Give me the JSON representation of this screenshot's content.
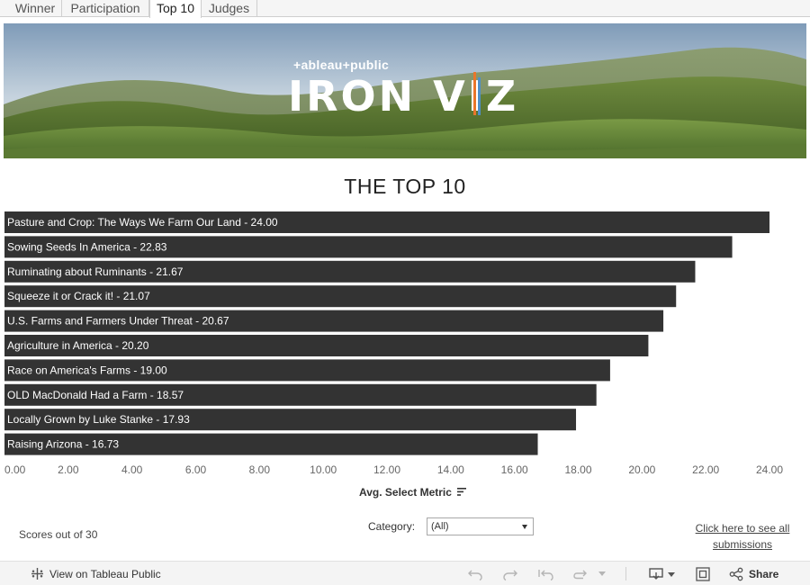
{
  "tabs": [
    {
      "label": "Winner"
    },
    {
      "label": "Participation"
    },
    {
      "label": "Top 10"
    },
    {
      "label": "Judges"
    }
  ],
  "active_tab": "Top 10",
  "banner": {
    "brand_text": "+ableau+public",
    "logo_text": "IRON VIZ"
  },
  "chart_data": {
    "type": "bar",
    "orientation": "horizontal",
    "title": "THE TOP 10",
    "xlabel": "Avg. Select Metric",
    "xlim": [
      0,
      24.8
    ],
    "ticks": [
      "0.00",
      "2.00",
      "4.00",
      "6.00",
      "8.00",
      "10.00",
      "12.00",
      "14.00",
      "16.00",
      "18.00",
      "20.00",
      "22.00",
      "24.00"
    ],
    "categories": [
      "Pasture and Crop: The Ways We Farm Our Land",
      "Sowing Seeds In America",
      "Ruminating about Ruminants",
      "Squeeze it or Crack it!",
      "U.S. Farms and Farmers Under Threat",
      "Agriculture in America",
      "Race on America's Farms",
      "OLD MacDonald Had a Farm",
      "Locally Grown by Luke Stanke",
      "Raising Arizona"
    ],
    "values": [
      24.0,
      22.83,
      21.67,
      21.07,
      20.67,
      20.2,
      19.0,
      18.57,
      17.93,
      16.73
    ],
    "labels": [
      "Pasture and Crop: The Ways We Farm Our Land - 24.00",
      "Sowing Seeds In America - 22.83",
      "Ruminating about Ruminants - 21.67",
      "Squeeze it or Crack it! - 21.07",
      "U.S. Farms and Farmers Under Threat - 20.67",
      "Agriculture in America - 20.20",
      "Race on America's Farms - 19.00",
      "OLD MacDonald Had a Farm - 18.57",
      "Locally Grown by Luke Stanke - 17.93",
      "Raising Arizona - 16.73"
    ],
    "bar_color": "#333333",
    "label_color": "#ffffff",
    "grid": false
  },
  "footer": {
    "scores_note": "Scores out of 30",
    "category_label": "Category:",
    "category_value": "(All)",
    "submissions_link": "Click here to see all submissions"
  },
  "toolbar": {
    "view_label": "View on Tableau Public",
    "share_label": "Share",
    "icons": [
      "tableau-logo-icon",
      "undo-icon",
      "redo-icon",
      "revert-icon",
      "refresh-icon",
      "download-icon",
      "fullscreen-icon",
      "share-icon"
    ]
  }
}
